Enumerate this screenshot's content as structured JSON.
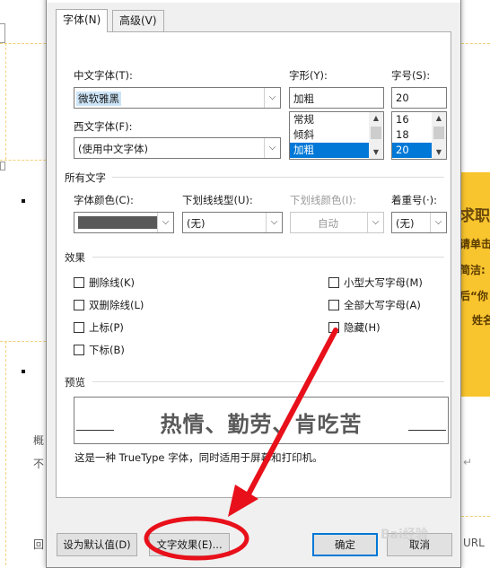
{
  "dialog": {
    "title": "字体",
    "close_glyph": "✕",
    "tabs": [
      {
        "label": "字体(N)",
        "active": true
      },
      {
        "label": "高级(V)",
        "active": false
      }
    ]
  },
  "fonts": {
    "chinese_font_label": "中文字体(T):",
    "chinese_font_value": "微软雅黑",
    "western_font_label": "西文字体(F):",
    "western_font_value": "(使用中文字体)",
    "style_label": "字形(Y):",
    "style_value": "加粗",
    "style_options": [
      "常规",
      "倾斜",
      "加粗"
    ],
    "size_label": "字号(S):",
    "size_value": "20",
    "size_options": [
      "16",
      "18",
      "20"
    ]
  },
  "all_text": {
    "section_label": "所有文字",
    "font_color_label": "字体颜色(C):",
    "font_color_hex": "#595959",
    "underline_style_label": "下划线线型(U):",
    "underline_style_value": "(无)",
    "underline_color_label": "下划线颜色(I):",
    "underline_color_value": "自动",
    "emphasis_label": "着重号(·):",
    "emphasis_value": "(无)"
  },
  "effects": {
    "section_label": "效果",
    "left": [
      "删除线(K)",
      "双删除线(L)",
      "上标(P)",
      "下标(B)"
    ],
    "right": [
      "小型大写字母(M)",
      "全部大写字母(A)",
      "隐藏(H)"
    ]
  },
  "preview": {
    "section_label": "预览",
    "sample_text": "热情、勤劳、肯吃苦",
    "note": "这是一种 TrueType 字体，同时适用于屏幕和打印机。"
  },
  "buttons": {
    "set_default": "设为默认值(D)",
    "text_effects": "文字效果(E)...",
    "ok": "确定",
    "cancel": "取消"
  },
  "background": {
    "panel_lines": [
      "求职",
      "请单击",
      "简洁:",
      "后“你",
      "姓名"
    ],
    "left_lines": [
      "概",
      "不"
    ],
    "bottom_left": "回",
    "bottom_right": "URL"
  },
  "watermark": "Bai经验",
  "colors": {
    "accent": "#0078d7",
    "annotation_red": "#e8101a",
    "panel_yellow": "#f9c52e"
  }
}
